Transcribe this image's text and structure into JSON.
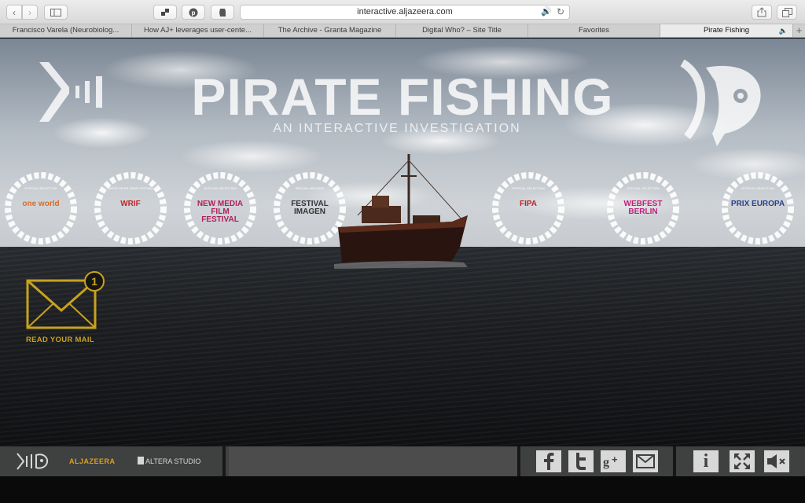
{
  "browser": {
    "url": "interactive.aljazeera.com",
    "tabs": [
      {
        "label": "Francisco Varela (Neurobiolog...",
        "active": false
      },
      {
        "label": "How AJ+ leverages user-cente...",
        "active": false
      },
      {
        "label": "The Archive - Granta Magazine",
        "active": false
      },
      {
        "label": "Digital Who? – Site Title",
        "active": false
      },
      {
        "label": "Favorites",
        "active": false
      },
      {
        "label": "Pirate Fishing",
        "active": true
      }
    ],
    "new_tab_glyph": "+"
  },
  "hero": {
    "title": "PIRATE FISHING",
    "subtitle": "AN INTERACTIVE INVESTIGATION"
  },
  "laurels": [
    {
      "top": "OFFICIAL SELECTION",
      "name": "one world",
      "color": "#e06a1e"
    },
    {
      "top": "WHITE RIVER INDIE FESTIVAL",
      "name": "WRIF",
      "color": "#c0282d"
    },
    {
      "top": "OFFICIAL SELECTION",
      "name": "NEW MEDIA FILM FESTIVAL",
      "color": "#b0205a"
    },
    {
      "top": "SPECIAL MENTION",
      "name": "FESTIVAL IMAGEN",
      "color": "#333333"
    },
    {
      "top": "OFFICIAL SELECTION",
      "name": "FIPA",
      "color": "#c4202a"
    },
    {
      "top": "OFFICIAL SELECTION",
      "name": "WEBFEST BERLIN",
      "color": "#c0207a"
    },
    {
      "top": "OFFICIAL SELECTION",
      "name": "PRIX EUROPA",
      "color": "#2b3f8a"
    }
  ],
  "mail": {
    "count": "1",
    "label": "READ YOUR MAIL"
  },
  "footer": {
    "aljazeera": "ALJAZEERA",
    "altera": "ALTERA STUDIO",
    "info_glyph": "i"
  },
  "icons": {
    "facebook": "facebook-icon",
    "twitter": "twitter-icon",
    "googleplus": "google-plus-icon",
    "email": "email-icon",
    "info": "info-icon",
    "fullscreen": "fullscreen-icon",
    "mute": "mute-icon"
  },
  "colors": {
    "gold": "#c8a21f",
    "footer": "#3f4040",
    "button": "#d8d8d8"
  }
}
